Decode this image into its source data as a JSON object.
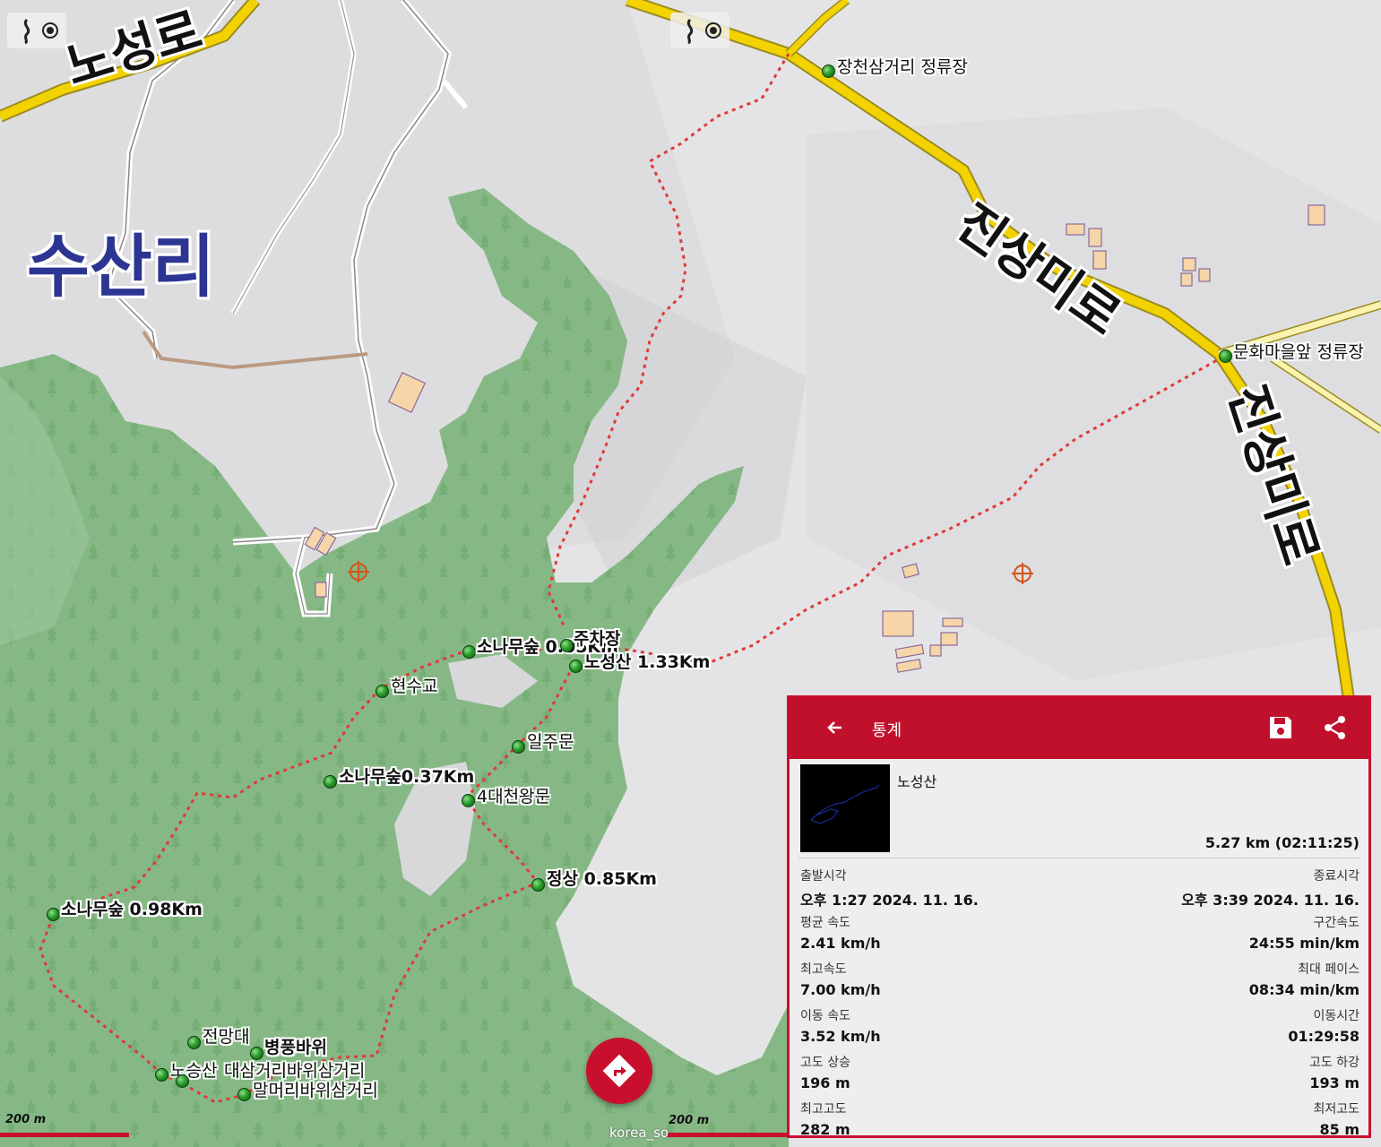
{
  "map": {
    "town_label": "수산리",
    "road_labels": [
      "노성로",
      "진상미로",
      "진상미로"
    ],
    "poi_labels": {
      "bus_stop_1": "장천삼거리 정류장",
      "bus_stop_2": "문화마을앞 정류장"
    },
    "waypoints": [
      {
        "label": "소나무숲 0.05Km"
      },
      {
        "label": "주차장"
      },
      {
        "label": "노성산 1.33Km"
      },
      {
        "label": "현수교"
      },
      {
        "label": "일주문"
      },
      {
        "label": "소나무숲0.37Km"
      },
      {
        "label": "4대천왕문"
      },
      {
        "label": "정상 0.85Km"
      },
      {
        "label": "소나무숲 0.98Km"
      },
      {
        "label": "전망대"
      },
      {
        "label": "병풍바위"
      },
      {
        "label": "노승산"
      },
      {
        "label": "대삼거리바위삼거리"
      },
      {
        "label": "말머리바위삼거리"
      }
    ],
    "scale_left": "200 m",
    "scale_right": "200 m",
    "attribution": "korea_so",
    "route_color": "#e03a3a",
    "road_color": "#f2d200"
  },
  "panel": {
    "header_title": "통계",
    "header_color": "#c1102c",
    "track_name": "노성산",
    "summary": "5.27 km (02:11:25)",
    "stats": [
      {
        "left_label": "출발시각",
        "left_value": "오후 1:27 2024. 11. 16.",
        "right_label": "종료시각",
        "right_value": "오후 3:39 2024. 11. 16."
      },
      {
        "left_label": "평균 속도",
        "left_value": "2.41 km/h",
        "right_label": "구간속도",
        "right_value": "24:55 min/km"
      },
      {
        "left_label": "최고속도",
        "left_value": "7.00 km/h",
        "right_label": "최대 페이스",
        "right_value": "08:34 min/km"
      },
      {
        "left_label": "이동 속도",
        "left_value": "3.52 km/h",
        "right_label": "이동시간",
        "right_value": "01:29:58"
      },
      {
        "left_label": "고도 상승",
        "left_value": "196 m",
        "right_label": "고도 하강",
        "right_value": "193 m"
      },
      {
        "left_label": "최고고도",
        "left_value": "282 m",
        "right_label": "최저고도",
        "right_value": "85 m"
      }
    ]
  }
}
